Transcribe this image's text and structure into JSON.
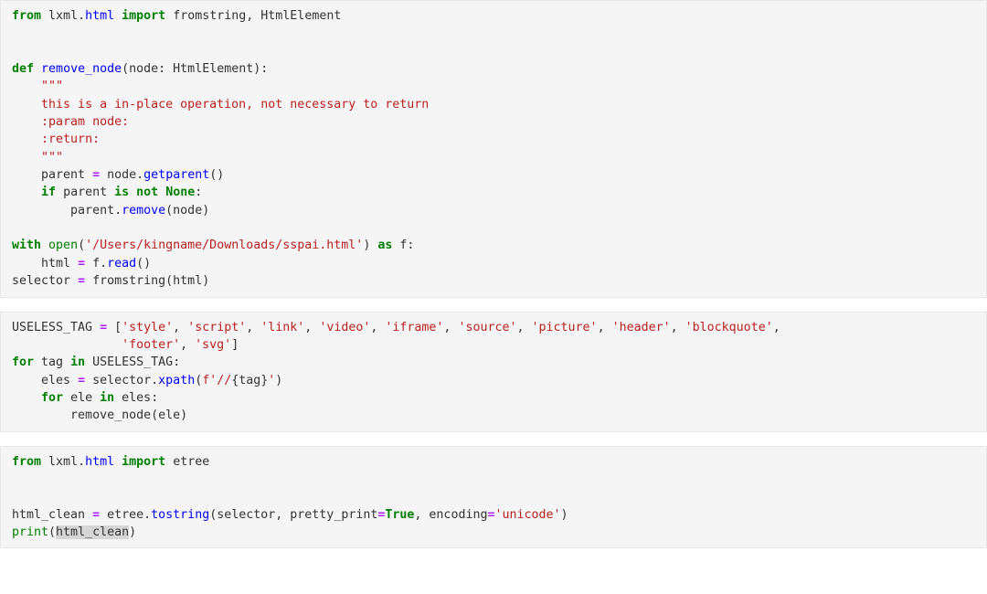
{
  "document": {
    "kind": "jupyter-notebook-code-cells",
    "background_color": "#ffffff",
    "cell_background_color": "#f5f5f5",
    "cell_border_color": "#e8e8e8",
    "language": "python",
    "syntax_colors": {
      "keyword": "#008000",
      "module": "#0000ff",
      "function_name": "#0000ff",
      "builtin": "#008000",
      "string": "#ba2121",
      "docstring": "#ba2121",
      "assignment_operator": "#aa22ff",
      "plain_text": "#333333",
      "occurrence_highlight": "#d6d6d6"
    }
  },
  "cells": [
    {
      "id": "cell-1",
      "lines": [
        "from lxml.html import fromstring, HtmlElement",
        "",
        "",
        "def remove_node(node: HtmlElement):",
        "    \"\"\"",
        "    this is a in-place operation, not necessary to return",
        "    :param node:",
        "    :return:",
        "    \"\"\"",
        "    parent = node.getparent()",
        "    if parent is not None:",
        "        parent.remove(node)",
        "",
        "with open('/Users/kingname/Downloads/sspai.html') as f:",
        "    html = f.read()",
        "selector = fromstring(html)"
      ]
    },
    {
      "id": "cell-2",
      "lines": [
        "USELESS_TAG = ['style', 'script', 'link', 'video', 'iframe', 'source', 'picture', 'header', 'blockquote',",
        "               'footer', 'svg']",
        "for tag in USELESS_TAG:",
        "    eles = selector.xpath(f'//{tag}')",
        "    for ele in eles:",
        "        remove_node(ele)"
      ]
    },
    {
      "id": "cell-3",
      "lines": [
        "from lxml.html import etree",
        "",
        "",
        "html_clean = etree.tostring(selector, pretty_print=True, encoding='unicode')",
        "print(html_clean)"
      ]
    }
  ],
  "tokens": {
    "kw_from": "from",
    "kw_import": "import",
    "kw_def": "def",
    "kw_if": "if",
    "kw_is": "is",
    "kw_not": "not",
    "kw_none": "None",
    "kw_with": "with",
    "kw_as": "as",
    "kw_for": "for",
    "kw_in": "in",
    "kw_true": "True",
    "mod_lxml": "lxml",
    "mod_html": "html",
    "fn_remove_node": "remove_node",
    "name_fromstring": "fromstring",
    "name_htmlelement": "HtmlElement",
    "name_etree": "etree",
    "builtin_print": "print",
    "str_path": "'/Users/kingname/Downloads/sspai.html'",
    "str_unicode": "'unicode'",
    "fstring_prefix": "f'//",
    "fstring_interp": "{tag}",
    "fstring_suffix": "'",
    "useless_tags": [
      "'style'",
      "'script'",
      "'link'",
      "'video'",
      "'iframe'",
      "'source'",
      "'picture'",
      "'header'",
      "'blockquote'",
      "'footer'",
      "'svg'"
    ],
    "docstring_quote": "\"\"\"",
    "doc_line_1": "this is a in-place operation, not necessary to return",
    "doc_line_2": ":param node:",
    "doc_line_3": ":return:",
    "var_parent": "parent",
    "var_node": "node",
    "var_html": "html",
    "var_selector": "selector",
    "var_f": "f",
    "var_tag": "tag",
    "var_eles": "eles",
    "var_ele": "ele",
    "var_useless_tag": "USELESS_TAG",
    "var_html_clean": "html_clean",
    "attr_getparent": "getparent",
    "attr_remove": "remove",
    "attr_read": "read",
    "attr_xpath": "xpath",
    "attr_tostring": "tostring",
    "kwarg_pretty_print": "pretty_print",
    "kwarg_encoding": "encoding",
    "fn_open": "open"
  }
}
